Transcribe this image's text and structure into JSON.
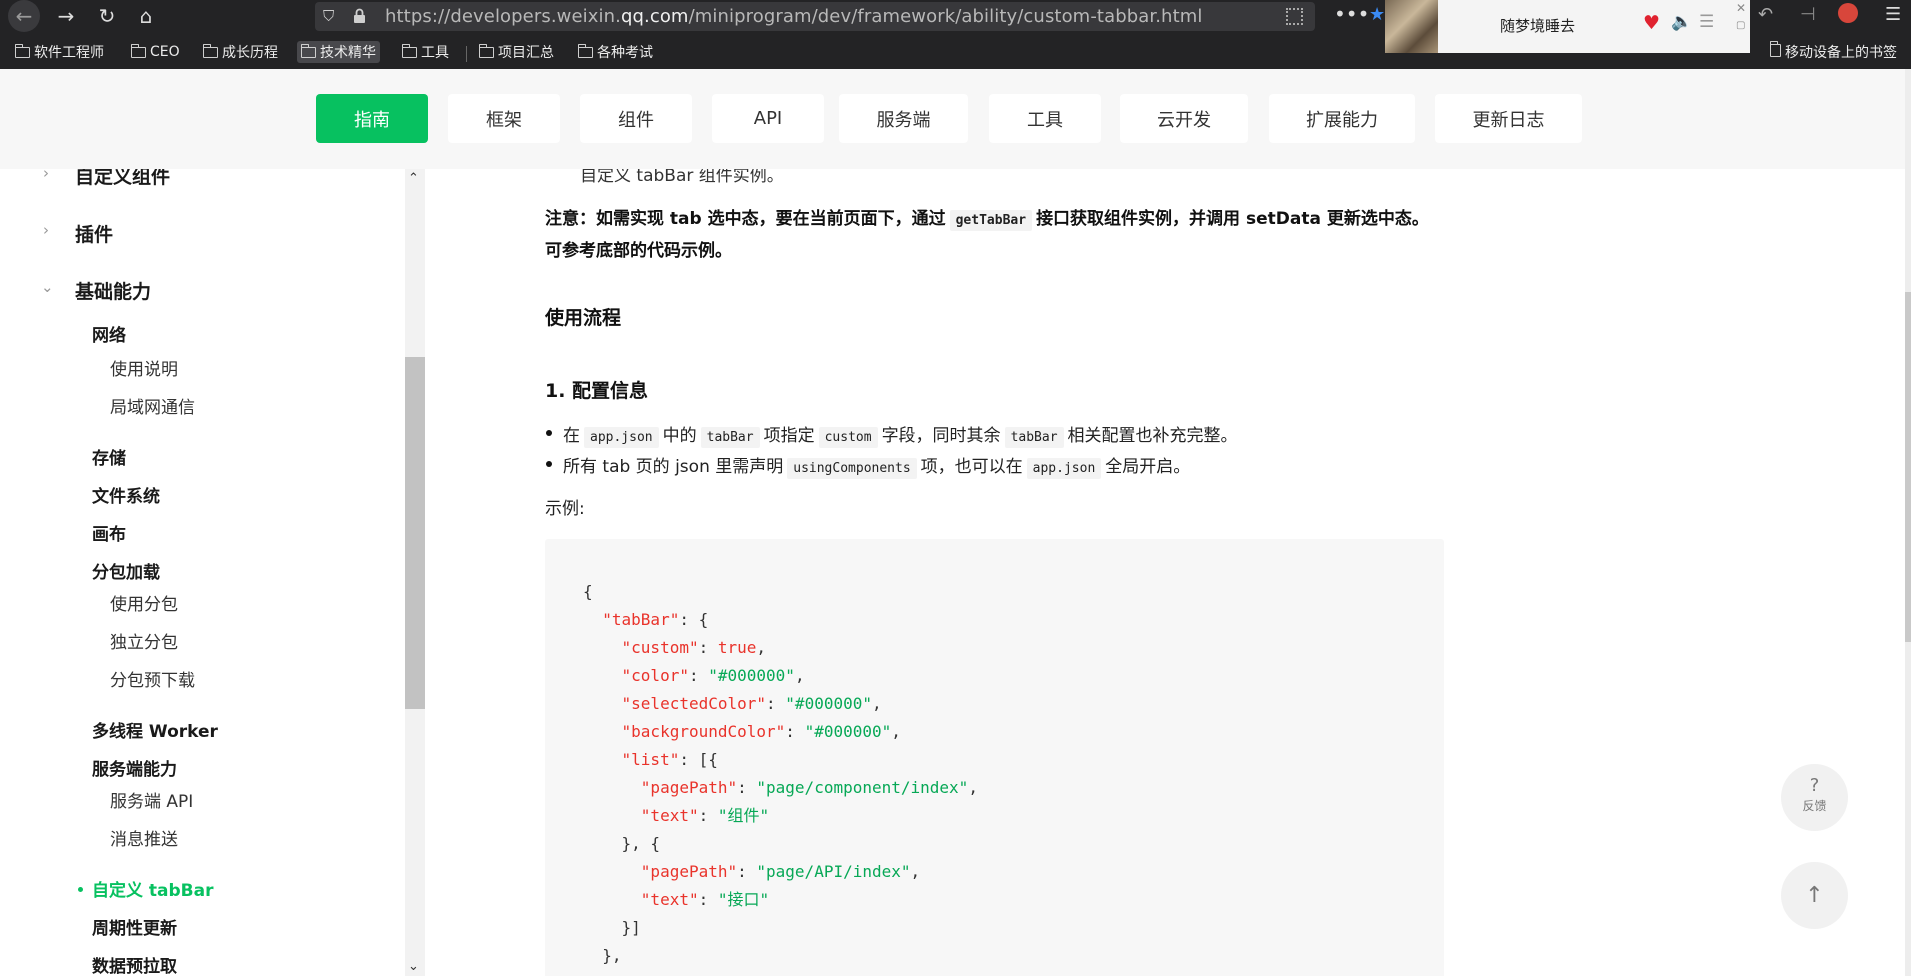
{
  "browser": {
    "url_prefix": "https://developers.weixin.",
    "url_host": "qq.com",
    "url_path": "/miniprogram/dev/framework/ability/custom-tabbar.html",
    "now_playing": "随梦境睡去",
    "bookmarks": [
      "软件工程师",
      "CEO",
      "成长历程",
      "技术精华",
      "工具",
      "项目汇总",
      "各种考试"
    ],
    "mobile_bookmarks": "移动设备上的书签",
    "icons": [
      "back-icon",
      "forward-icon",
      "reload-icon",
      "home-icon",
      "shield-icon",
      "lock-icon",
      "qr-icon",
      "more-icon",
      "bookmark-star-icon",
      "heart-icon",
      "speaker-icon",
      "menu-icon"
    ]
  },
  "topnav": {
    "tabs": [
      "指南",
      "框架",
      "组件",
      "API",
      "服务端",
      "工具",
      "云开发",
      "扩展能力",
      "更新日志"
    ],
    "active": "指南"
  },
  "sidebar": {
    "custom_components": "自定义组件",
    "plugins": "插件",
    "basic_capabilities": "基础能力",
    "network": "网络",
    "network_usage": "使用说明",
    "network_lan": "局域网通信",
    "storage": "存储",
    "filesystem": "文件系统",
    "canvas": "画布",
    "subpackages": "分包加载",
    "use_subpackages": "使用分包",
    "independent_subpackages": "独立分包",
    "preload_subpackages": "分包预下载",
    "worker": "多线程 Worker",
    "server_capabilities": "服务端能力",
    "server_api": "服务端 API",
    "push_messages": "消息推送",
    "custom_tabbar": "自定义 tabBar",
    "periodic_update": "周期性更新",
    "prefetch": "数据预拉取"
  },
  "content": {
    "cut_line": "自定义 tabBar 组件实例。",
    "note_line1_pre": "注意：如需实现 tab 选中态，要在当前页面下，通过",
    "note_code": "getTabBar",
    "note_line1_post": "接口获取组件实例，并调用 setData 更新选中态。",
    "note_line2": "可参考底部的代码示例。",
    "section_flow": "使用流程",
    "section_config": "1. 配置信息",
    "bullet1": {
      "t1": "在",
      "c1": "app.json",
      "t2": "中的",
      "c2": "tabBar",
      "t3": "项指定",
      "c3": "custom",
      "t4": "字段，同时其余",
      "c4": "tabBar",
      "t5": "相关配置也补充完整。"
    },
    "bullet2": {
      "t1": "所有 tab 页的 json 里需声明",
      "c1": "usingComponents",
      "t2": "项，也可以在",
      "c2": "app.json",
      "t3": "全局开启。"
    },
    "example_label": "示例:",
    "code": {
      "open": "{",
      "tabBar": "\"tabBar\"",
      "custom": "\"custom\"",
      "custom_v": "true",
      "color": "\"color\"",
      "color_v": "\"#000000\"",
      "selectedColor": "\"selectedColor\"",
      "selectedColor_v": "\"#000000\"",
      "backgroundColor": "\"backgroundColor\"",
      "backgroundColor_v": "\"#000000\"",
      "list": "\"list\"",
      "pagePath1": "\"pagePath\"",
      "pagePath1_v": "\"page/component/index\"",
      "text1": "\"text\"",
      "text1_v": "\"组件\"",
      "pagePath2": "\"pagePath\"",
      "pagePath2_v": "\"page/API/index\"",
      "text2": "\"text\"",
      "text2_v": "\"接口\""
    }
  },
  "floating": {
    "feedback_label": "反馈",
    "feedback_glyph": "?",
    "top_glyph": "↑"
  },
  "colors": {
    "accent": "#07c160",
    "code_key": "#e9332b",
    "code_string": "#07a856",
    "chrome_bg": "#232325"
  }
}
